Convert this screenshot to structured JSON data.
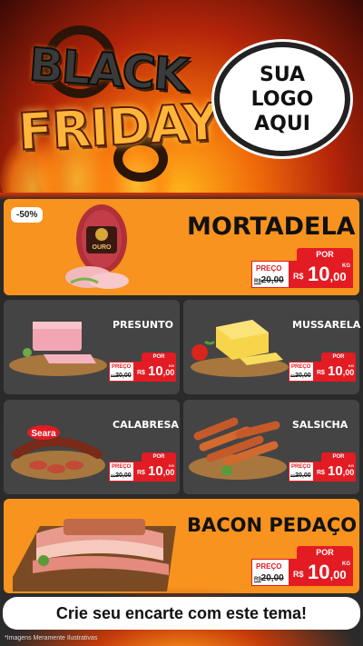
{
  "header": {
    "black": "BLACK",
    "friday": "FRIDAY",
    "logo_lines": [
      "SUA",
      "LOGO",
      "AQUI"
    ]
  },
  "featured": [
    {
      "name": "MORTADELA",
      "badge": "-50%",
      "product_label": "OURO",
      "por": "POR",
      "preco": "PREÇO",
      "old_currency": "R$",
      "old_price": "20,00",
      "currency": "R$",
      "price_int": "10",
      "price_dec": ",00",
      "unit": "KG"
    },
    {
      "name": "BACON PEDAÇO",
      "por": "POR",
      "preco": "PREÇO",
      "old_currency": "R$",
      "old_price": "20,00",
      "currency": "R$",
      "price_int": "10",
      "price_dec": ",00",
      "unit": "KG"
    }
  ],
  "cards": [
    {
      "name": "PRESUNTO",
      "por": "POR",
      "preco": "PREÇO",
      "old_currency": "R$",
      "old_price": "20,00",
      "currency": "R$",
      "price_int": "10",
      "price_dec": ",00",
      "unit": "KG"
    },
    {
      "name": "MUSSARELA",
      "por": "POR",
      "preco": "PREÇO",
      "old_currency": "R$",
      "old_price": "20,00",
      "currency": "R$",
      "price_int": "10",
      "price_dec": ",00",
      "unit": "KG"
    },
    {
      "name": "CALABRESA",
      "brand": "Seara",
      "por": "POR",
      "preco": "PREÇO",
      "old_currency": "R$",
      "old_price": "20,00",
      "currency": "R$",
      "price_int": "10",
      "price_dec": ",00",
      "unit": "KG"
    },
    {
      "name": "SALSICHA",
      "por": "POR",
      "preco": "PREÇO",
      "old_currency": "R$",
      "old_price": "20,00",
      "currency": "R$",
      "price_int": "10",
      "price_dec": ",00",
      "unit": "KG"
    }
  ],
  "footer": {
    "cta": "Crie seu encarte com este tema!",
    "disclaimer": "*Imagens Meramente Ilustrativas"
  },
  "colors": {
    "accent_orange": "#f7931e",
    "price_red": "#e31b23",
    "card_gray": "#444444"
  }
}
